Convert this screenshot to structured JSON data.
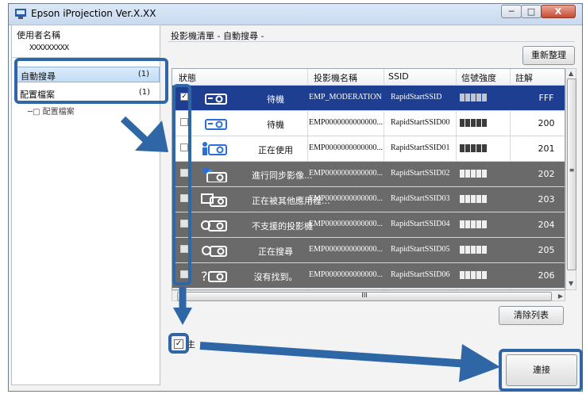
{
  "window": {
    "title": "Epson iProjection Ver.X.XX",
    "minimize": "─",
    "maximize": "□",
    "close": "X"
  },
  "sidebar": {
    "user_label": "使用者名稱",
    "user_name": "XXXXXXXXX",
    "items": [
      {
        "label": "自動搜尋",
        "count": "(1)"
      },
      {
        "label": "配置檔案",
        "count": "(1)"
      }
    ],
    "tree_stub": "─□ 配置檔案"
  },
  "main": {
    "list_title": "投影機清單 - 自動搜尋 -",
    "refresh_button": "重新整理",
    "clear_button": "清除列表",
    "connect_button": "連接",
    "columns": [
      "狀態",
      "投影機名稱",
      "SSID",
      "信號強度",
      "註解"
    ],
    "rows": [
      {
        "checked": "✓",
        "status": "待機",
        "name": "EMP_MODERATION",
        "ssid": "RapidStartSSID",
        "note": "FFF",
        "signal_bars": 5,
        "style": "sel",
        "icon": "projector-icon"
      },
      {
        "checked": "",
        "status": "待機",
        "name": "EMP0000000000000...",
        "ssid": "RapidStartSSID00",
        "note": "200",
        "signal_bars": 5,
        "style": "normal",
        "icon": "projector-icon"
      },
      {
        "checked": "",
        "status": "正在使用",
        "name": "EMP0000000000000...",
        "ssid": "RapidStartSSID01",
        "note": "201",
        "signal_bars": 5,
        "style": "normal",
        "icon": "projector-in-use-icon"
      },
      {
        "checked": "",
        "status": "進行同步影像...",
        "name": "EMP0000000000000...",
        "ssid": "RapidStartSSID02",
        "note": "202",
        "signal_bars": 5,
        "style": "gray",
        "icon": "projector-sync-icon"
      },
      {
        "checked": "",
        "status": "正在被其他應用程...",
        "name": "EMP0000000000000...",
        "ssid": "RapidStartSSID03",
        "note": "203",
        "signal_bars": 5,
        "style": "gray",
        "icon": "projector-other-app-icon"
      },
      {
        "checked": "",
        "status": "不支援的投影機",
        "name": "EMP0000000000000...",
        "ssid": "RapidStartSSID04",
        "note": "204",
        "signal_bars": 5,
        "style": "gray",
        "icon": "projector-unsupported-icon"
      },
      {
        "checked": "",
        "status": "正在搜尋",
        "name": "EMP0000000000000...",
        "ssid": "RapidStartSSID05",
        "note": "205",
        "signal_bars": 5,
        "style": "gray",
        "icon": "projector-searching-icon"
      },
      {
        "checked": "",
        "status": "沒有找到。",
        "name": "EMP0000000000000...",
        "ssid": "RapidStartSSID06",
        "note": "206",
        "signal_bars": 5,
        "style": "gray",
        "icon": "projector-not-found-icon"
      }
    ],
    "hscroll_grip": "III",
    "vscroll_grip": "≡",
    "bottom_checkbox": "✓",
    "bottom_text": "主"
  },
  "colors": {
    "highlight_blue": "#2f66a6",
    "selected_row": "#1e3f91",
    "disabled_row": "#6a6a6a"
  }
}
